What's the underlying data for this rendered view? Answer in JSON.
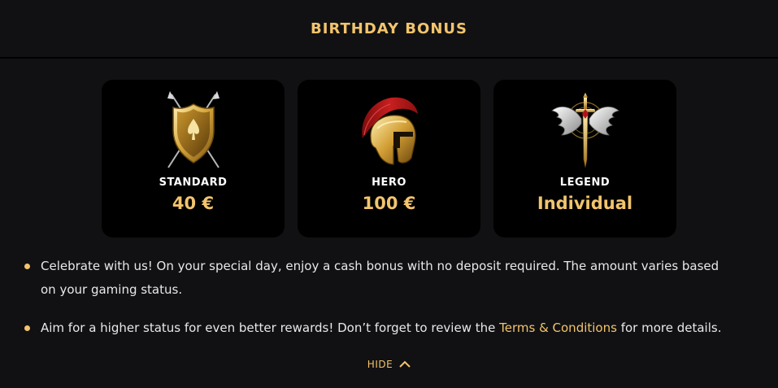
{
  "header": {
    "title": "BIRTHDAY BONUS"
  },
  "tiers": [
    {
      "name": "STANDARD",
      "value": "40 €",
      "icon": "shield-icon"
    },
    {
      "name": "HERO",
      "value": "100 €",
      "icon": "helmet-icon"
    },
    {
      "name": "LEGEND",
      "value": "Individual",
      "icon": "winged-sword-icon"
    }
  ],
  "bullets": [
    {
      "text": "Celebrate with us! On your special day, enjoy a cash bonus with no deposit required. The amount varies based on your gaming status."
    },
    {
      "text_before": "Aim for a higher status for even better rewards! Don’t forget to review the ",
      "link": "Terms & Conditions",
      "text_after": " for more details."
    }
  ],
  "toggle": {
    "label": "HIDE",
    "icon": "chevron-up-icon"
  },
  "colors": {
    "accent": "#f2c46d",
    "background": "#111113",
    "card": "#000000"
  }
}
